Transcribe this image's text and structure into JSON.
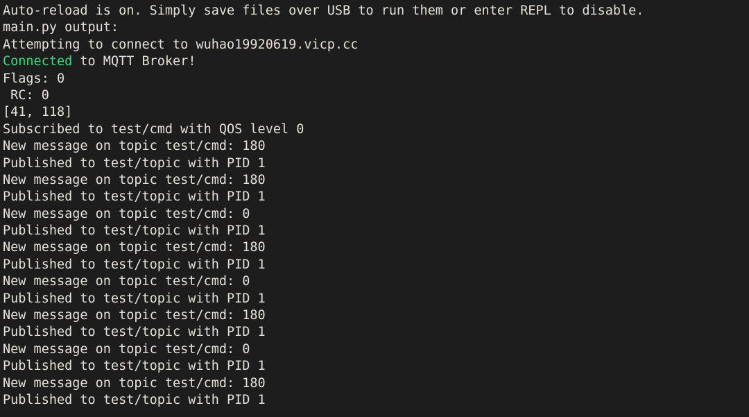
{
  "terminal": {
    "background_color": "#1d1d1d",
    "text_color": "#e6e1d8",
    "accent_color": "#2ee07b",
    "font_size_px": 18.5,
    "line_height_px": 24.4,
    "lines": [
      {
        "text": "Auto-reload is on. Simply save files over USB to run them or enter REPL to disable."
      },
      {
        "text": "main.py output:"
      },
      {
        "text": "Attempting to connect to wuhao19920619.vicp.cc"
      },
      {
        "segments": [
          {
            "text": "Connected",
            "style": "ok"
          },
          {
            "text": " to MQTT Broker!",
            "style": "plain"
          }
        ]
      },
      {
        "text": "Flags: 0"
      },
      {
        "text": " RC: 0"
      },
      {
        "text": "[41, 118]"
      },
      {
        "text": "Subscribed to test/cmd with QOS level 0"
      },
      {
        "text": "New message on topic test/cmd: 180"
      },
      {
        "text": "Published to test/topic with PID 1"
      },
      {
        "text": "New message on topic test/cmd: 180"
      },
      {
        "text": "Published to test/topic with PID 1"
      },
      {
        "text": "New message on topic test/cmd: 0"
      },
      {
        "text": "Published to test/topic with PID 1"
      },
      {
        "text": "New message on topic test/cmd: 180"
      },
      {
        "text": "Published to test/topic with PID 1"
      },
      {
        "text": "New message on topic test/cmd: 0"
      },
      {
        "text": "Published to test/topic with PID 1"
      },
      {
        "text": "New message on topic test/cmd: 180"
      },
      {
        "text": "Published to test/topic with PID 1"
      },
      {
        "text": "New message on topic test/cmd: 0"
      },
      {
        "text": "Published to test/topic with PID 1"
      },
      {
        "text": "New message on topic test/cmd: 180"
      },
      {
        "text": "Published to test/topic with PID 1"
      }
    ]
  }
}
